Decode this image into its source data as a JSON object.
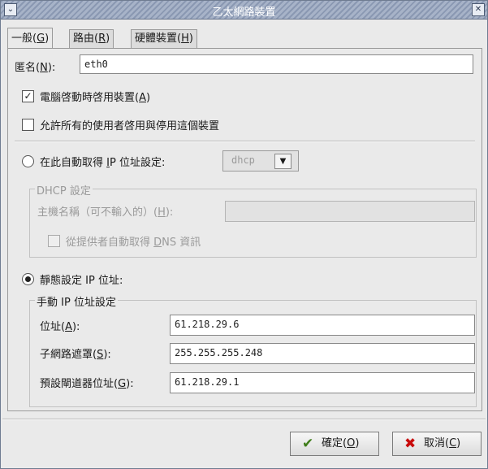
{
  "window": {
    "title": "乙太網路裝置",
    "menu_glyph": "⌄",
    "close_glyph": "✕"
  },
  "tabs": [
    {
      "label": "一般(",
      "key": "G",
      "end": ")"
    },
    {
      "label": "路由(",
      "key": "R",
      "end": ")"
    },
    {
      "label": "硬體裝置(",
      "key": "H",
      "end": ")"
    }
  ],
  "general": {
    "nickname_label": "匿名(",
    "nickname_key": "N",
    "nickname_end": "):",
    "nickname_value": "eth0",
    "activate_on_boot": {
      "label": "電腦啓動時啓用裝置(",
      "key": "A",
      "end": ")",
      "checked": true
    },
    "allow_users": {
      "label": "允許所有的使用者啓用與停用這個裝置",
      "checked": false
    },
    "auto_ip": {
      "label_prefix": "在此自動取得 ",
      "label_key": "I",
      "label_suffix": "P 位址設定:",
      "selected": false,
      "method": "dhcp"
    },
    "dhcp": {
      "title": "DHCP 設定",
      "hostname_label": "主機名稱（可不輸入的）(",
      "hostname_key": "H",
      "hostname_end": "):",
      "hostname_value": "",
      "dns_prefix": "從提供者自動取得 ",
      "dns_key": "D",
      "dns_suffix": "NS 資訊",
      "dns_checked": false
    },
    "static_ip": {
      "label": "靜態設定 IP 位址:",
      "selected": true,
      "title": "手動 IP 位址設定",
      "address_label": "位址(",
      "address_key": "A",
      "address_end": "):",
      "address": "61.218.29.6",
      "netmask_label": "子網路遮罩(",
      "netmask_key": "S",
      "netmask_end": "):",
      "netmask": "255.255.255.248",
      "gateway_label": "預設閘道器位址(",
      "gateway_key": "G",
      "gateway_end": "):",
      "gateway": "61.218.29.1"
    }
  },
  "buttons": {
    "ok_label": "確定(",
    "ok_key": "O",
    "ok_end": ")",
    "cancel_label": "取消(",
    "cancel_key": "C",
    "cancel_end": ")"
  },
  "icons": {
    "ok": "check-icon",
    "cancel": "x-icon",
    "combo_arrow": "chevron-down-icon"
  },
  "colors": {
    "titlebar": "#9aa7bf",
    "background": "#eaeaea",
    "ok_icon": "#3f7d1a",
    "cancel_icon": "#c80a0a"
  }
}
